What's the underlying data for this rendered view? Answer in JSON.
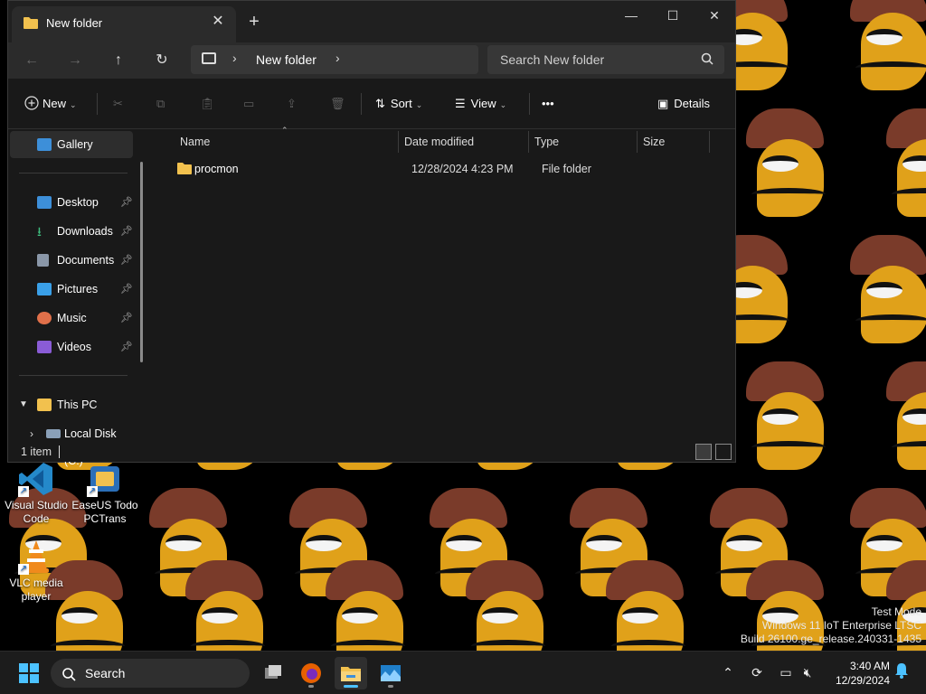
{
  "explorer": {
    "tab_title": "New folder",
    "breadcrumb": "New folder",
    "search_placeholder": "Search New folder",
    "toolbar": {
      "new_label": "New",
      "sort_label": "Sort",
      "view_label": "View",
      "more_label": "•••",
      "details_label": "Details"
    },
    "sidebar": {
      "gallery": "Gallery",
      "pinned": [
        "Desktop",
        "Downloads",
        "Documents",
        "Pictures",
        "Music",
        "Videos"
      ],
      "this_pc": "This PC",
      "local_disk": "Local Disk (C:)"
    },
    "columns": {
      "name": "Name",
      "date": "Date modified",
      "type": "Type",
      "size": "Size"
    },
    "files": [
      {
        "name": "procmon",
        "date": "12/28/2024 4:23 PM",
        "type": "File folder",
        "size": ""
      }
    ],
    "status": "1 item"
  },
  "desktop": {
    "icons": [
      {
        "label": "Visual Studio Code"
      },
      {
        "label": "EaseUS Todo PCTrans"
      },
      {
        "label": "VLC media player"
      }
    ],
    "watermark": {
      "line1": "Test Mode",
      "line2": "Windows 11 IoT Enterprise LTSC",
      "line3": "Build 26100.ge_release.240331-1435"
    }
  },
  "taskbar": {
    "search_label": "Search",
    "time": "3:40 AM",
    "date": "12/29/2024"
  },
  "colors": {
    "folder_yellow": "#f2c14e",
    "accent_blue": "#4cc2ff",
    "wallpaper_hat": "#7a3b2a",
    "wallpaper_face": "#e0a11a"
  }
}
